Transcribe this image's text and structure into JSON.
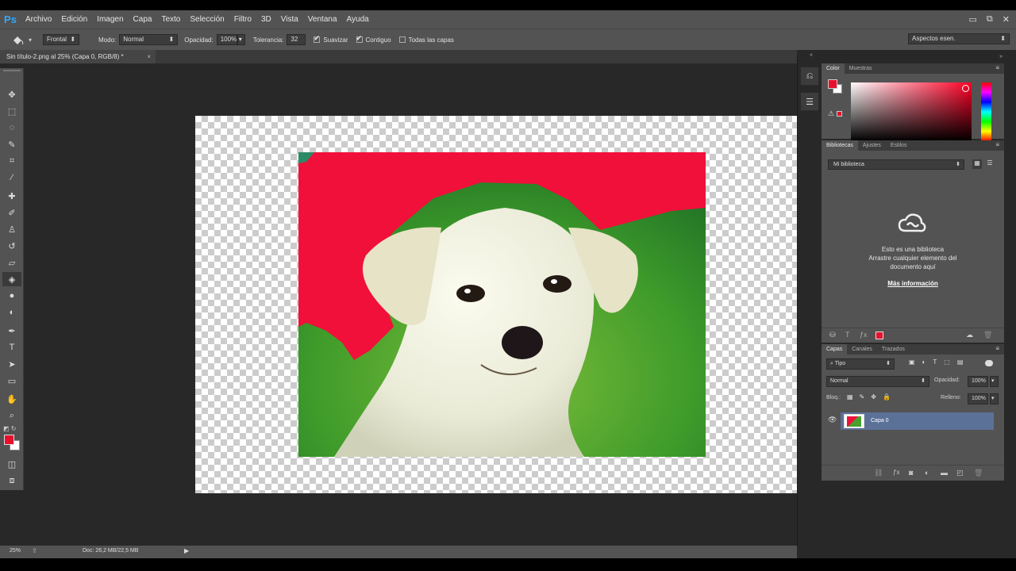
{
  "app": {
    "logo": "Ps"
  },
  "menu": [
    "Archivo",
    "Edición",
    "Imagen",
    "Capa",
    "Texto",
    "Selección",
    "Filtro",
    "3D",
    "Vista",
    "Ventana",
    "Ayuda"
  ],
  "window_controls": {
    "minimize": "▭",
    "restore": "⧉",
    "close": "✕"
  },
  "options": {
    "fill_source": "Frontal",
    "mode_label": "Modo:",
    "mode_value": "Normal",
    "opacity_label": "Opacidad:",
    "opacity_value": "100%",
    "tolerance_label": "Tolerancia:",
    "tolerance_value": "32",
    "smooth_label": "Suavizar",
    "contiguous_label": "Contiguo",
    "all_layers_label": "Todas las capas",
    "workspace": "Aspectos esen."
  },
  "document": {
    "tab_title": "Sin título-2.png al 25% (Capa 0, RGB/8) *",
    "close": "×"
  },
  "tools": [
    {
      "name": "move-tool",
      "glyph": "✥"
    },
    {
      "name": "marquee-tool",
      "glyph": "⬚"
    },
    {
      "name": "lasso-tool",
      "glyph": "◌"
    },
    {
      "name": "quick-select-tool",
      "glyph": "✎"
    },
    {
      "name": "crop-tool",
      "glyph": "⌗"
    },
    {
      "name": "eyedropper-tool",
      "glyph": "⁄"
    },
    {
      "name": "healing-tool",
      "glyph": "✚"
    },
    {
      "name": "brush-tool",
      "glyph": "✐"
    },
    {
      "name": "clone-stamp-tool",
      "glyph": "♙"
    },
    {
      "name": "history-brush-tool",
      "glyph": "↺"
    },
    {
      "name": "eraser-tool",
      "glyph": "▱"
    },
    {
      "name": "paint-bucket-tool",
      "glyph": "◈"
    },
    {
      "name": "blur-tool",
      "glyph": "●"
    },
    {
      "name": "dodge-tool",
      "glyph": "◐"
    },
    {
      "name": "pen-tool",
      "glyph": "✒"
    },
    {
      "name": "type-tool",
      "glyph": "T"
    },
    {
      "name": "path-select-tool",
      "glyph": "➤"
    },
    {
      "name": "shape-tool",
      "glyph": "▭"
    },
    {
      "name": "hand-tool",
      "glyph": "✋"
    },
    {
      "name": "zoom-tool",
      "glyph": "⌕"
    }
  ],
  "panels": {
    "color": {
      "tabs": [
        "Color",
        "Muestras"
      ]
    },
    "libraries": {
      "tabs": [
        "Bibliotecas",
        "Ajustes",
        "Estilos"
      ],
      "library_name": "Mi biblioteca",
      "empty_line1": "Esto es una biblioteca",
      "empty_line2": "Arrastre cualquier elemento del",
      "empty_line3": "documento aquí",
      "more_info": "Más información"
    },
    "layers": {
      "tabs": [
        "Capas",
        "Canales",
        "Trazados"
      ],
      "filter_label": "Tipo",
      "blend_mode": "Normal",
      "opacity_label": "Opacidad:",
      "opacity_value": "100%",
      "lock_label": "Bloq.:",
      "fill_label": "Relleno:",
      "fill_value": "100%",
      "layer_name": "Capa 0"
    }
  },
  "status": {
    "zoom": "25%",
    "doc_info": "Doc: 26,2 MB/22,5 MB"
  },
  "colors": {
    "foreground": "#e8102c",
    "background": "#ffffff",
    "layer_selected": "#5b7198"
  }
}
